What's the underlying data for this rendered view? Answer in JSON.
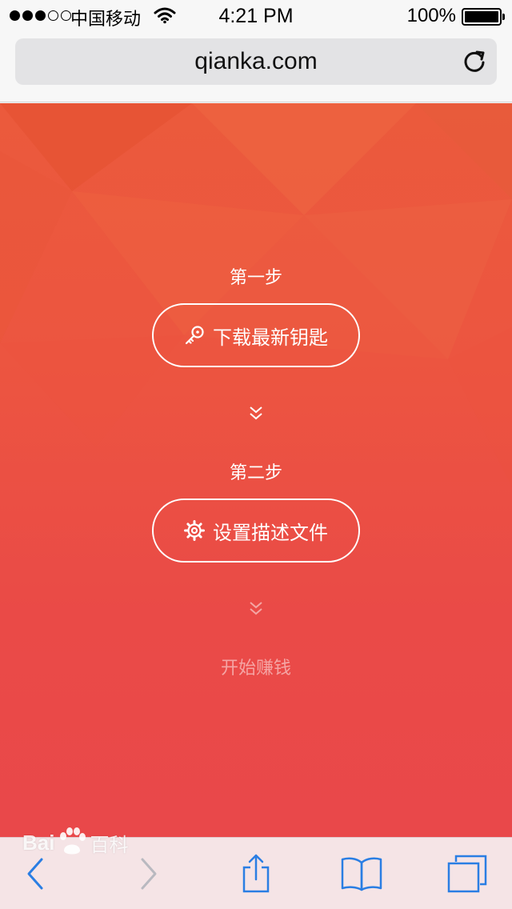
{
  "status_bar": {
    "carrier": "中国移动",
    "time": "4:21 PM",
    "battery": "100%"
  },
  "browser": {
    "url": "qianka.com"
  },
  "steps": [
    {
      "label": "第一步",
      "button": "下载最新钥匙",
      "icon": "key-icon"
    },
    {
      "label": "第二步",
      "button": "设置描述文件",
      "icon": "gear-icon"
    }
  ],
  "final_step": "开始赚钱",
  "watermark": {
    "latin": "Bai",
    "cjk": "百科"
  },
  "colors": {
    "background_top": "#eb5a3c",
    "background_bottom": "#e9484a",
    "toolbar_tint": "#2a7ee3"
  }
}
